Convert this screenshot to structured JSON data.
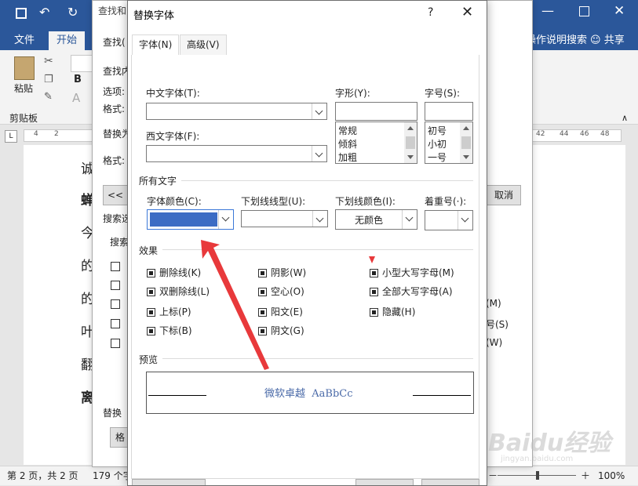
{
  "word": {
    "ribbon_tabs": {
      "file": "文件",
      "home": "开始",
      "tell_me": "操作说明搜索",
      "share": "共享"
    },
    "ribbon": {
      "paste": "粘贴",
      "clipboard": "剪贴板",
      "bold": "B"
    },
    "ruler_left": [
      "4",
      "2"
    ],
    "ruler_right": [
      "42",
      "44",
      "46",
      "48"
    ],
    "doc_chars": [
      "诚",
      "蝉",
      "今",
      "的",
      "的",
      "叶",
      "翻",
      "离"
    ],
    "status": {
      "page": "第 2 页，共 2 页",
      "words": "179 个字",
      "zoom": "100%",
      "zoom_minus": "－",
      "zoom_plus": "＋"
    }
  },
  "find_replace": {
    "title": "查找和",
    "tab_find": "查找(",
    "find_label": "查找内",
    "options_label": "选项:",
    "format_label": "格式:",
    "replace_label": "替换为",
    "format_label2": "格式:",
    "less_button": "<< ",
    "cancel_button": "取消",
    "search_options": "搜索选",
    "search_label": "搜索",
    "replace_section": "替换",
    "format_button": "格",
    "right_items": [
      "(M)",
      "号(S)",
      "(W)"
    ]
  },
  "font_dialog": {
    "title": "替换字体",
    "help": "?",
    "close": "✕",
    "tab_font": "字体(N)",
    "tab_advanced": "高级(V)",
    "chinese_font_label": "中文字体(T):",
    "western_font_label": "西文字体(F):",
    "style_label": "字形(Y):",
    "size_label": "字号(S):",
    "styles": [
      "常规",
      "倾斜",
      "加粗"
    ],
    "sizes": [
      "初号",
      "小初",
      "一号"
    ],
    "all_text": "所有文字",
    "font_color_label": "字体颜色(C):",
    "font_color_value": "#3c6cc4",
    "underline_style_label": "下划线线型(U):",
    "underline_color_label": "下划线颜色(I):",
    "underline_color_value": "无颜色",
    "emphasis_label": "着重号(·):",
    "effects_title": "效果",
    "effects_col1": [
      "删除线(K)",
      "双删除线(L)",
      "上标(P)",
      "下标(B)"
    ],
    "effects_col2": [
      "阴影(W)",
      "空心(O)",
      "阳文(E)",
      "阴文(G)"
    ],
    "effects_col3": [
      "小型大写字母(M)",
      "全部大写字母(A)",
      "隐藏(H)"
    ],
    "preview_title": "预览",
    "preview_text": "微软卓越  AaBbCc",
    "preview_color": "#4a6aa8"
  },
  "watermark": "Baidu经验",
  "watermark_sub": "jingyan.baidu.com",
  "colors": {
    "word_blue": "#2b579a",
    "arrow_red": "#e8393b"
  }
}
